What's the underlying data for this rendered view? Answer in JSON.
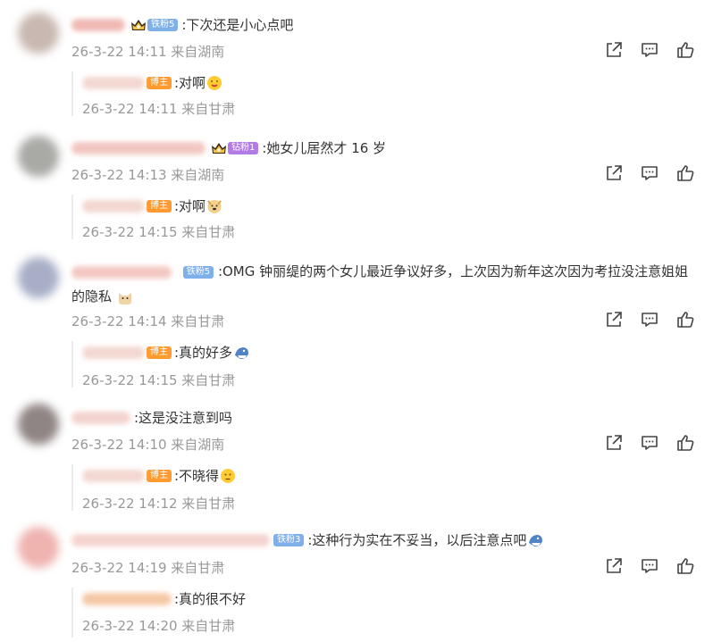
{
  "comments": [
    {
      "text": ":下次还是小心点吧",
      "fan_badge": "铁粉5",
      "meta": "26-3-22 14:11 来自湖南",
      "reply": {
        "badge": "博主",
        "text": ":对啊",
        "emoji": "drooling-face-emoji",
        "meta": "26-3-22 14:11 来自甘肃"
      }
    },
    {
      "text": ":她女儿居然才 16 岁",
      "fan_badge": "钻粉1",
      "meta": "26-3-22 14:13 来自湖南",
      "reply": {
        "badge": "博主",
        "text": ":对啊",
        "emoji": "doge-emoji",
        "meta": "26-3-22 14:15 来自甘肃"
      }
    },
    {
      "text": ":OMG 钟丽缇的两个女儿最近争议好多，上次因为新年这次因为考拉没注意姐姐的隐私",
      "fan_badge": "铁粉5",
      "meta": "26-3-22 14:14 来自甘肃",
      "reply": {
        "badge": "博主",
        "text": ":真的好多",
        "emoji": "shark-emoji",
        "meta": "26-3-22 14:15 来自甘肃"
      }
    },
    {
      "text": ":这是没注意到吗",
      "meta": "26-3-22 14:10 来自湖南",
      "reply": {
        "badge": "博主",
        "text": ":不晓得",
        "emoji": "thinking-face-emoji",
        "meta": "26-3-22 14:12 来自甘肃"
      }
    },
    {
      "text": ":这种行为实在不妥当，以后注意点吧",
      "fan_badge": "铁粉3",
      "emoji": "shark-emoji",
      "meta": "26-3-22 14:19 来自甘肃",
      "reply": {
        "text": ":真的很不好",
        "meta": "26-3-22 14:20 来自甘肃"
      }
    }
  ],
  "icons": {
    "share": "share-icon",
    "comment": "comment-icon",
    "like": "like-icon"
  },
  "colors": {
    "meta": "#999999",
    "bozhu_badge": "#ff9a2e",
    "iron_badge": "#7fb0ea",
    "diamond_badge": "#b37be6"
  }
}
